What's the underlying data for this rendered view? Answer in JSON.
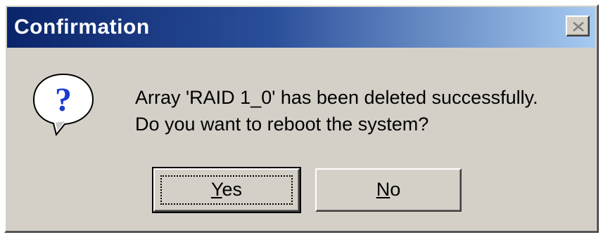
{
  "dialog": {
    "title": "Confirmation",
    "message_line1": "Array 'RAID 1_0' has been deleted successfully.",
    "message_line2": "Do you want to reboot the system?",
    "icon": "question-icon",
    "close_icon": "close-icon"
  },
  "buttons": {
    "yes": {
      "mnemonic": "Y",
      "rest": "es"
    },
    "no": {
      "mnemonic": "N",
      "rest": "o"
    }
  },
  "colors": {
    "title_gradient_start": "#0a246a",
    "title_gradient_end": "#a6caf0",
    "face": "#d4d0c8",
    "icon_blue": "#1a3ccf"
  }
}
